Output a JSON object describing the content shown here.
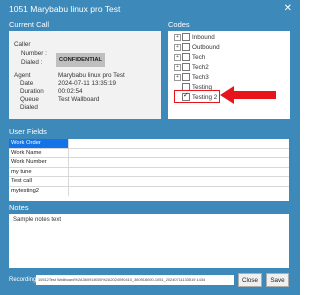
{
  "window": {
    "title": "1051 Marybabu linux pro Test",
    "close_glyph": "✕"
  },
  "current_call": {
    "section_label": "Current Call",
    "caller_label": "Caller",
    "number_label": "Number :",
    "number_value": "CONFIDENTIAL",
    "dialed_label": "Dialed :",
    "agent_label": "Agent",
    "agent_value": "Marybabu linux pro Test",
    "date_label": "Date",
    "date_value": "2024-07-11 13:35:19",
    "duration_label": "Duration",
    "duration_value": "00:02:54",
    "queue_label": "Queue",
    "queue_value": "Test Wallboard",
    "dialed2_label": "Dialed"
  },
  "codes": {
    "section_label": "Codes",
    "items": [
      {
        "label": "Inbound",
        "expandable": true,
        "checked": false
      },
      {
        "label": "Outbound",
        "expandable": true,
        "checked": false
      },
      {
        "label": "Tech",
        "expandable": true,
        "checked": false
      },
      {
        "label": "Tech2",
        "expandable": true,
        "checked": false
      },
      {
        "label": "Tech3",
        "expandable": true,
        "checked": false
      },
      {
        "label": "Testing",
        "expandable": false,
        "checked": false
      },
      {
        "label": "Testing 2",
        "expandable": false,
        "checked": true
      }
    ],
    "highlight_color": "#e8141b"
  },
  "user_fields": {
    "section_label": "User Fields",
    "rows": [
      {
        "key": "Work Order",
        "value": ""
      },
      {
        "key": "Work Name",
        "value": ""
      },
      {
        "key": "Work Number",
        "value": ""
      },
      {
        "key": "my tune",
        "value": ""
      },
      {
        "key": "Test call",
        "value": ""
      },
      {
        "key": "mytesting2",
        "value": ""
      }
    ],
    "selected_color": "#1473e6"
  },
  "notes": {
    "section_label": "Notes",
    "text": "Sample notes text"
  },
  "recording": {
    "label": "Recording:",
    "path": "10512Test Wallboard%2A360918000%2A2024090410_360918000-1051_20240711133519 1434"
  },
  "buttons": {
    "close": "Close",
    "save": "Save"
  },
  "colors": {
    "window_bg": "#3d89b9",
    "panel_bg": "#f2f2f2"
  }
}
